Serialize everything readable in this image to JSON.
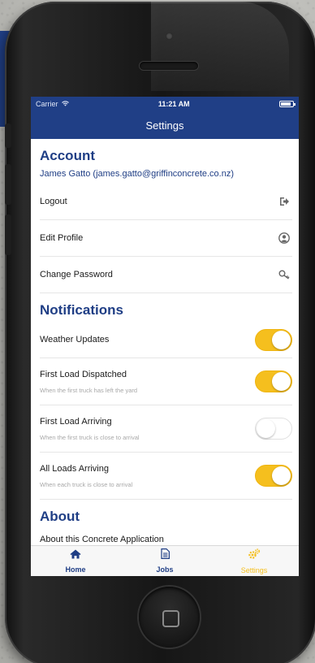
{
  "status_bar": {
    "carrier": "Carrier",
    "time": "11:21 AM"
  },
  "nav": {
    "title": "Settings"
  },
  "account": {
    "heading": "Account",
    "user": "James Gatto (james.gatto@griffinconcrete.co.nz)",
    "items": [
      {
        "label": "Logout",
        "icon": "logout-icon"
      },
      {
        "label": "Edit Profile",
        "icon": "user-circle-icon"
      },
      {
        "label": "Change Password",
        "icon": "key-icon"
      }
    ]
  },
  "notifications": {
    "heading": "Notifications",
    "items": [
      {
        "label": "Weather Updates",
        "subtitle": "",
        "enabled": true
      },
      {
        "label": "First Load Dispatched",
        "subtitle": "When the first truck has left the yard",
        "enabled": true
      },
      {
        "label": "First Load Arriving",
        "subtitle": "When the first truck is close to arrival",
        "enabled": false
      },
      {
        "label": "All Loads Arriving",
        "subtitle": "When each truck is close to arrival",
        "enabled": true
      }
    ]
  },
  "about": {
    "heading": "About",
    "partial_row": "About this Concrete Application"
  },
  "tabs": [
    {
      "label": "Home",
      "icon": "home-icon",
      "active": false
    },
    {
      "label": "Jobs",
      "icon": "document-icon",
      "active": false
    },
    {
      "label": "Settings",
      "icon": "gears-icon",
      "active": true
    }
  ],
  "colors": {
    "brand_blue": "#203f86",
    "toggle_on": "#f5bf1e",
    "active_tab": "#f5bf1e"
  }
}
